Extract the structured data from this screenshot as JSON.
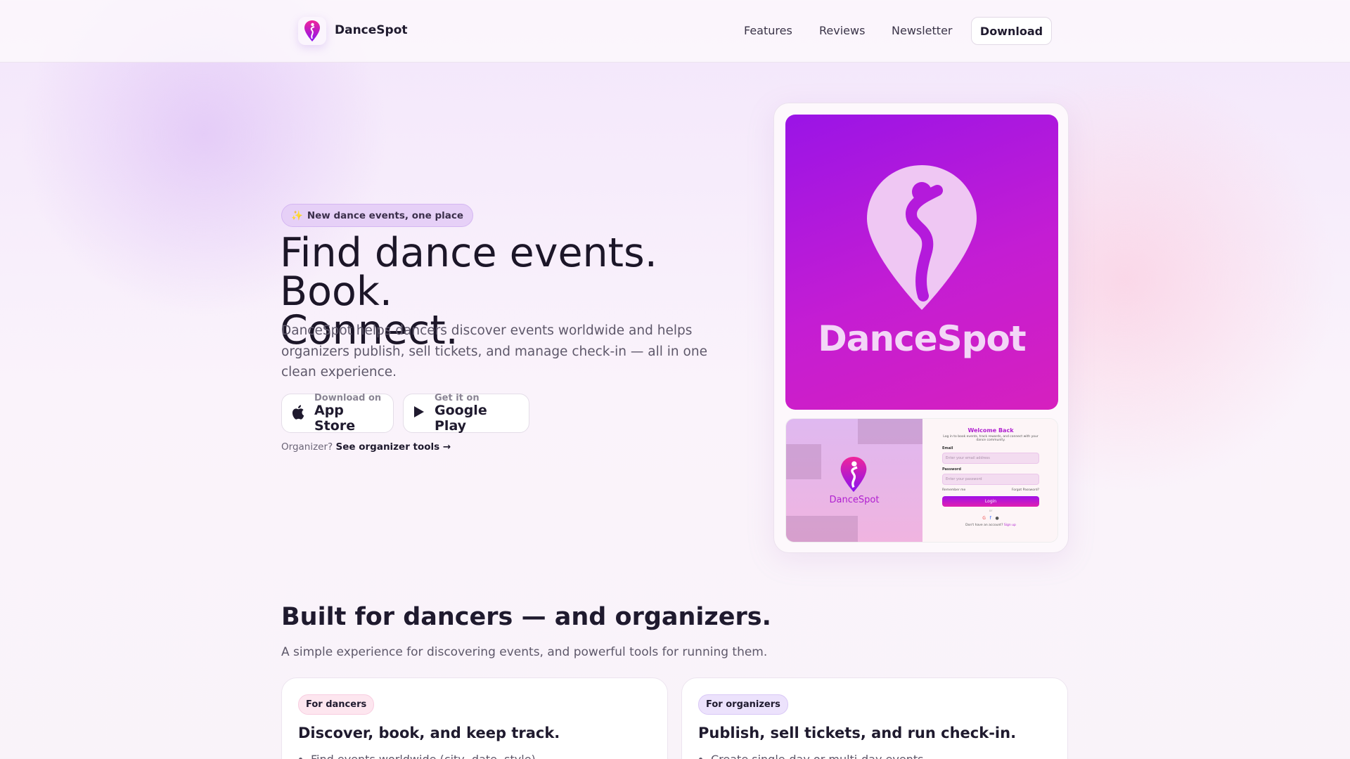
{
  "header": {
    "brand": "DanceSpot",
    "nav": [
      "Features",
      "Reviews",
      "Newsletter"
    ],
    "download": "Download"
  },
  "hero": {
    "badge_icon": "✨",
    "badge": "New dance events, one place",
    "title_line1": "Find dance events. Book.",
    "title_line2": "Connect.",
    "lead": "DanceSpot helps dancers discover events worldwide and helps organizers publish, sell tickets, and manage check-in — all in one clean experience.",
    "app_store": {
      "small": "Download on",
      "big": "App Store"
    },
    "google_play": {
      "small": "Get it on",
      "big": "Google Play"
    },
    "organizer_prefix": "Organizer?",
    "organizer_link": "See organizer tools →"
  },
  "mockup": {
    "brand": "DanceSpot",
    "login": {
      "title": "Welcome Back",
      "subtitle": "Log in to book events, track rewards, and connect with your dance community.",
      "email_label": "Email",
      "email_placeholder": "Enter your email address",
      "password_label": "Password",
      "password_placeholder": "Enter your password",
      "remember": "Remember me",
      "forgot": "Forgot Password?",
      "login": "Login",
      "or": "or",
      "signup_prefix": "Don't have an account?",
      "signup": "Sign up"
    }
  },
  "features": {
    "title": "Built for dancers — and organizers.",
    "subtitle": "A simple experience for discovering events, and powerful tools for running them.",
    "cards": [
      {
        "tag": "For dancers",
        "title": "Discover, book, and keep track.",
        "items": [
          "Find events worldwide (city, date, style)"
        ]
      },
      {
        "tag": "For organizers",
        "title": "Publish, sell tickets, and run check-in.",
        "items": [
          "Create single-day or multi-day events"
        ]
      }
    ]
  }
}
